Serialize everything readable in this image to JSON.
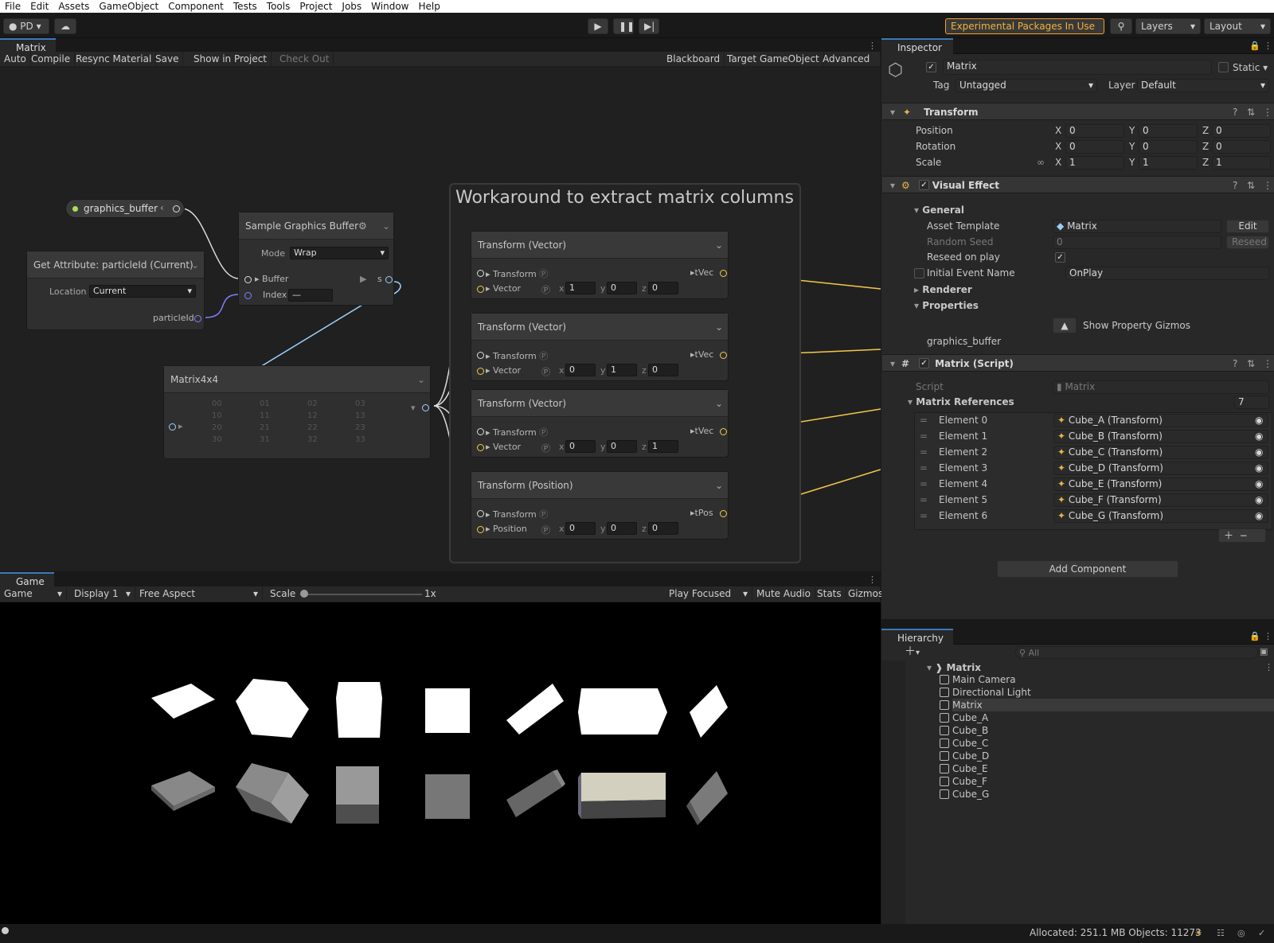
{
  "menu": [
    "File",
    "Edit",
    "Assets",
    "GameObject",
    "Component",
    "Tests",
    "Tools",
    "Project",
    "Jobs",
    "Window",
    "Help"
  ],
  "toolbar": {
    "account": "PD",
    "experimental": "Experimental Packages In Use",
    "layers": "Layers",
    "layout": "Layout"
  },
  "vfx": {
    "tab": "Matrix",
    "buttons": [
      "Auto",
      "Compile",
      "Resync Material",
      "Save",
      "Show in Project",
      "Check Out"
    ],
    "right_buttons": [
      "Blackboard",
      "Target GameObject",
      "Advanced"
    ],
    "property_node": "graphics_buffer",
    "sample_node": {
      "title": "Sample Graphics Buffer",
      "mode_label": "Mode",
      "mode": "Wrap",
      "buffer": "Buffer",
      "index": "Index",
      "index_val": "—",
      "out": "s"
    },
    "attr_node": {
      "title": "Get Attribute: particleId (Current)",
      "location_label": "Location",
      "location": "Current",
      "out": "particleId"
    },
    "matrix_node": {
      "title": "Matrix4x4",
      "cells": [
        "00",
        "01",
        "02",
        "03",
        "10",
        "11",
        "12",
        "13",
        "20",
        "21",
        "22",
        "23",
        "30",
        "31",
        "32",
        "33"
      ]
    },
    "sticky": "Workaround to extract matrix columns",
    "transform_nodes": [
      {
        "title": "Transform (Vector)",
        "in1": "Transform",
        "in2": "Vector",
        "x": "1",
        "y": "0",
        "z": "0",
        "out": "tVec"
      },
      {
        "title": "Transform (Vector)",
        "in1": "Transform",
        "in2": "Vector",
        "x": "0",
        "y": "1",
        "z": "0",
        "out": "tVec"
      },
      {
        "title": "Transform (Vector)",
        "in1": "Transform",
        "in2": "Vector",
        "x": "0",
        "y": "0",
        "z": "1",
        "out": "tVec"
      },
      {
        "title": "Transform (Position)",
        "in1": "Transform",
        "in2": "Position",
        "x": "0",
        "y": "0",
        "z": "0",
        "out": "tPos"
      }
    ]
  },
  "game": {
    "tab": "Game",
    "view": "Game",
    "display": "Display 1",
    "aspect": "Free Aspect",
    "scale_label": "Scale",
    "scale": "1x",
    "play": "Play Focused",
    "mute": "Mute Audio",
    "stats": "Stats",
    "gizmos": "Gizmos"
  },
  "inspector": {
    "tab": "Inspector",
    "name": "Matrix",
    "static": "Static",
    "tag_label": "Tag",
    "tag": "Untagged",
    "layer_label": "Layer",
    "layer": "Default",
    "transform": {
      "title": "Transform",
      "rows": [
        {
          "label": "Position",
          "x": "0",
          "y": "0",
          "z": "0"
        },
        {
          "label": "Rotation",
          "x": "0",
          "y": "0",
          "z": "0"
        },
        {
          "label": "Scale",
          "x": "1",
          "y": "1",
          "z": "1"
        }
      ]
    },
    "vfx": {
      "title": "Visual Effect",
      "general": "General",
      "asset_label": "Asset Template",
      "asset": "Matrix",
      "edit": "Edit",
      "seed_label": "Random Seed",
      "seed": "0",
      "reseed": "Reseed",
      "reseed_play": "Reseed on play",
      "event_label": "Initial Event Name",
      "event": "OnPlay",
      "renderer": "Renderer",
      "properties": "Properties",
      "gizmos": "Show Property Gizmos",
      "prop": "graphics_buffer"
    },
    "script": {
      "title": "Matrix (Script)",
      "script_label": "Script",
      "script": "Matrix",
      "refs": "Matrix References",
      "count": "7",
      "elements": [
        {
          "label": "Element 0",
          "value": "Cube_A (Transform)"
        },
        {
          "label": "Element 1",
          "value": "Cube_B (Transform)"
        },
        {
          "label": "Element 2",
          "value": "Cube_C (Transform)"
        },
        {
          "label": "Element 3",
          "value": "Cube_D (Transform)"
        },
        {
          "label": "Element 4",
          "value": "Cube_E (Transform)"
        },
        {
          "label": "Element 5",
          "value": "Cube_F (Transform)"
        },
        {
          "label": "Element 6",
          "value": "Cube_G (Transform)"
        }
      ]
    },
    "add_component": "Add Component"
  },
  "hierarchy": {
    "tab": "Hierarchy",
    "search": "All",
    "scene": "Matrix",
    "items": [
      "Main Camera",
      "Directional Light",
      "Matrix",
      "Cube_A",
      "Cube_B",
      "Cube_C",
      "Cube_D",
      "Cube_E",
      "Cube_F",
      "Cube_G"
    ]
  },
  "status": "Allocated: 251.1 MB Objects: 11273"
}
